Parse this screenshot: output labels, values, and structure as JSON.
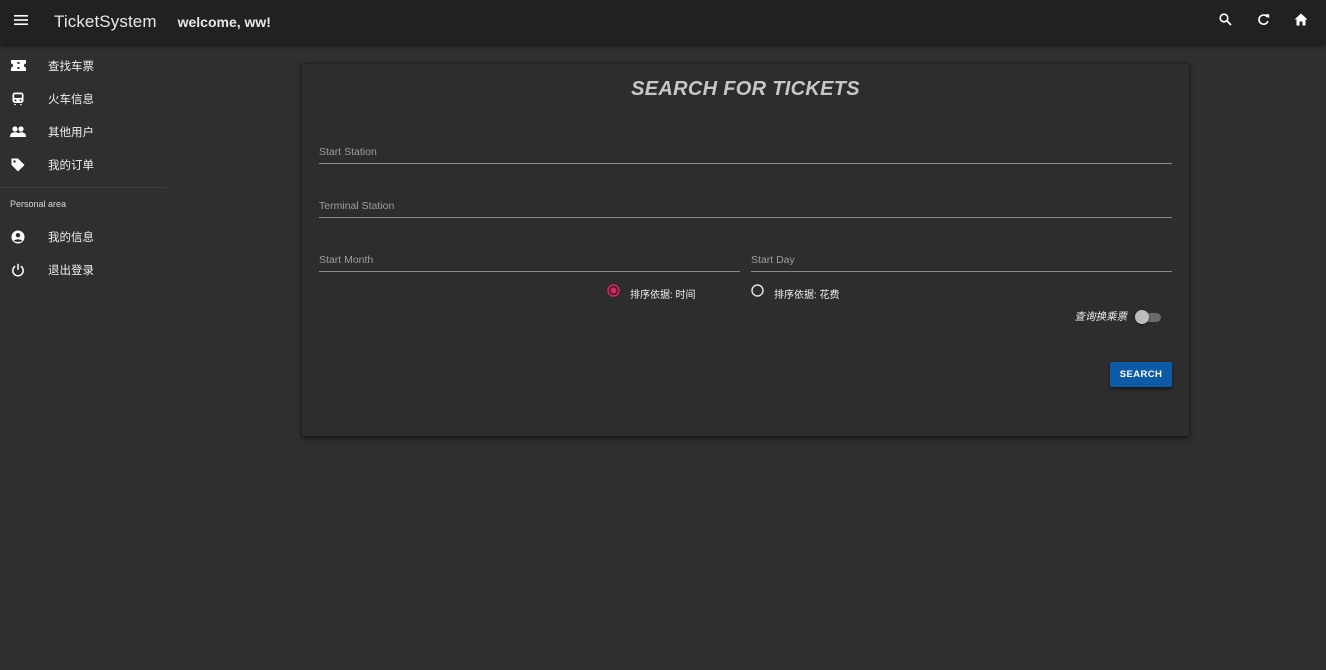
{
  "topbar": {
    "title": "TicketSystem",
    "welcome": "welcome, ww!",
    "icons": [
      "menu-icon",
      "search-icon",
      "refresh-icon",
      "home-icon"
    ]
  },
  "sidebar": {
    "items": [
      {
        "label": "查找车票",
        "icon": "ticket-icon"
      },
      {
        "label": "火车信息",
        "icon": "train-icon"
      },
      {
        "label": "其他用户",
        "icon": "people-icon"
      },
      {
        "label": "我的订单",
        "icon": "tag-icon"
      }
    ],
    "section_header": "Personal area",
    "personal_items": [
      {
        "label": "我的信息",
        "icon": "account-circle-icon"
      },
      {
        "label": "退出登录",
        "icon": "power-icon"
      }
    ]
  },
  "form": {
    "title": "SEARCH FOR TICKETS",
    "start_station_placeholder": "Start Station",
    "terminal_station_placeholder": "Terminal Station",
    "start_month_placeholder": "Start Month",
    "start_day_placeholder": "Start Day",
    "sort_options": [
      {
        "label": "排序依据: 时间",
        "selected": true
      },
      {
        "label": "排序依据: 花费",
        "selected": false
      }
    ],
    "transfer_toggle_label": "查询换乘票",
    "transfer_toggle_on": false,
    "search_button": "SEARCH"
  },
  "colors": {
    "background": "#2f2f2f",
    "topbar": "#212121",
    "card": "#2d2d2d",
    "accent_radio": "#e91e63",
    "button": "#0d5aa7"
  }
}
